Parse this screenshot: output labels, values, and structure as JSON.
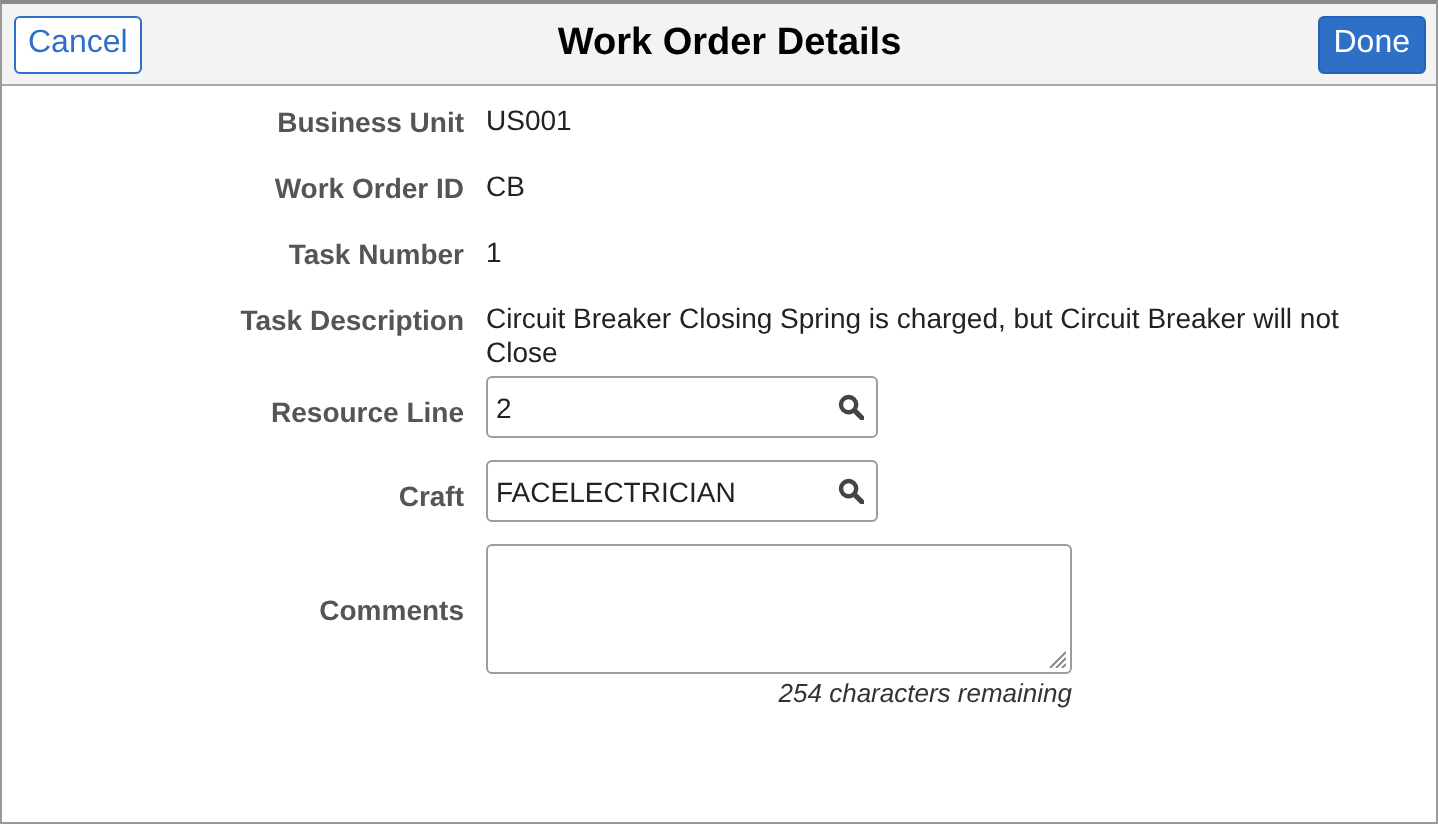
{
  "header": {
    "cancel": "Cancel",
    "title": "Work Order Details",
    "done": "Done"
  },
  "fields": [
    {
      "kind": "text",
      "label": "Business Unit",
      "value": "US001"
    },
    {
      "kind": "text",
      "label": "Work Order ID",
      "value": "CB"
    },
    {
      "kind": "text",
      "label": "Task Number",
      "value": "1"
    },
    {
      "kind": "text",
      "label": "Task Description",
      "value": "Circuit Breaker Closing Spring is charged, but Circuit Breaker will not Close"
    },
    {
      "kind": "lookup",
      "label": "Resource Line",
      "value": "2"
    },
    {
      "kind": "lookup",
      "label": "Craft",
      "value": "FACELECTRICIAN"
    },
    {
      "kind": "textarea",
      "label": "Comments",
      "note": "254 characters remaining"
    }
  ]
}
